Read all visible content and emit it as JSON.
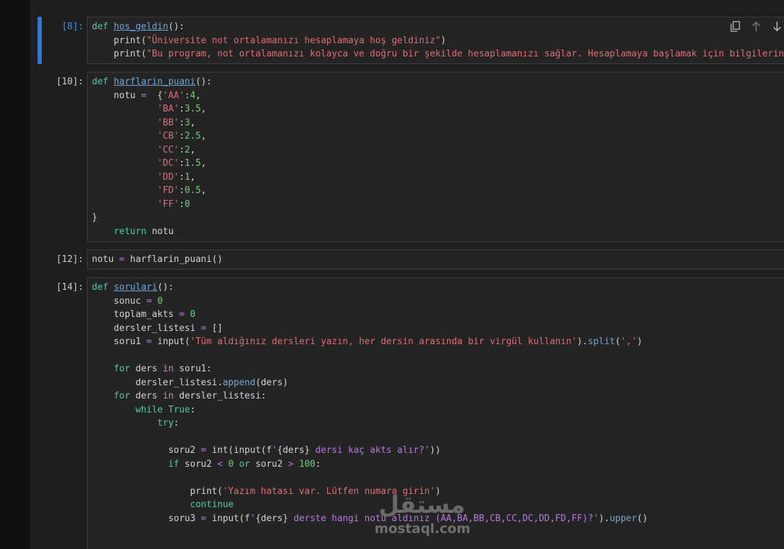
{
  "cells": [
    {
      "prompt": "[8]:",
      "active": true,
      "lines": [
        [
          [
            "kw",
            "def "
          ],
          [
            "fn",
            "hos_geldin"
          ],
          [
            "plain",
            "():"
          ]
        ],
        [
          [
            "plain",
            "    print("
          ],
          [
            "str",
            "\"Üniversite not ortalamanızı hesaplamaya hoş geldiniz\""
          ],
          [
            "plain",
            ")"
          ]
        ],
        [
          [
            "plain",
            "    print("
          ],
          [
            "str",
            "\"Bu program, not ortalamanızı kolayca ve doğru bir şekilde hesaplamanızı sağlar. Hesaplamaya başlamak için bilgilerinizi"
          ]
        ]
      ]
    },
    {
      "prompt": "[10]:",
      "active": false,
      "lines": [
        [
          [
            "kw",
            "def "
          ],
          [
            "fn",
            "harflarin_puani"
          ],
          [
            "plain",
            "():"
          ]
        ],
        [
          [
            "plain",
            "    notu "
          ],
          [
            "op",
            "="
          ],
          [
            "plain",
            "  {"
          ],
          [
            "str",
            "'AA'"
          ],
          [
            "plain",
            ":"
          ],
          [
            "num",
            "4"
          ],
          [
            "plain",
            ","
          ]
        ],
        [
          [
            "plain",
            "            "
          ],
          [
            "str",
            "'BA'"
          ],
          [
            "plain",
            ":"
          ],
          [
            "num",
            "3.5"
          ],
          [
            "plain",
            ","
          ]
        ],
        [
          [
            "plain",
            "            "
          ],
          [
            "str",
            "'BB'"
          ],
          [
            "plain",
            ":"
          ],
          [
            "num",
            "3"
          ],
          [
            "plain",
            ","
          ]
        ],
        [
          [
            "plain",
            "            "
          ],
          [
            "str",
            "'CB'"
          ],
          [
            "plain",
            ":"
          ],
          [
            "num",
            "2.5"
          ],
          [
            "plain",
            ","
          ]
        ],
        [
          [
            "plain",
            "            "
          ],
          [
            "str",
            "'CC'"
          ],
          [
            "plain",
            ":"
          ],
          [
            "num",
            "2"
          ],
          [
            "plain",
            ","
          ]
        ],
        [
          [
            "plain",
            "            "
          ],
          [
            "str",
            "'DC'"
          ],
          [
            "plain",
            ":"
          ],
          [
            "num",
            "1.5"
          ],
          [
            "plain",
            ","
          ]
        ],
        [
          [
            "plain",
            "            "
          ],
          [
            "str",
            "'DD'"
          ],
          [
            "plain",
            ":"
          ],
          [
            "num",
            "1"
          ],
          [
            "plain",
            ","
          ]
        ],
        [
          [
            "plain",
            "            "
          ],
          [
            "str",
            "'FD'"
          ],
          [
            "plain",
            ":"
          ],
          [
            "num",
            "0.5"
          ],
          [
            "plain",
            ","
          ]
        ],
        [
          [
            "plain",
            "            "
          ],
          [
            "str",
            "'FF'"
          ],
          [
            "plain",
            ":"
          ],
          [
            "num",
            "0"
          ]
        ],
        [
          [
            "plain",
            "}"
          ]
        ],
        [
          [
            "plain",
            "    "
          ],
          [
            "kw",
            "return"
          ],
          [
            "plain",
            " notu"
          ]
        ]
      ]
    },
    {
      "prompt": "[12]:",
      "active": false,
      "lines": [
        [
          [
            "plain",
            "notu "
          ],
          [
            "op",
            "="
          ],
          [
            "plain",
            " harflarin_puani()"
          ]
        ]
      ]
    },
    {
      "prompt": "[14]:",
      "active": false,
      "lines": [
        [
          [
            "kw",
            "def "
          ],
          [
            "fn",
            "sorulari"
          ],
          [
            "plain",
            "():"
          ]
        ],
        [
          [
            "plain",
            "    sonuc "
          ],
          [
            "op",
            "="
          ],
          [
            "plain",
            " "
          ],
          [
            "num",
            "0"
          ]
        ],
        [
          [
            "plain",
            "    toplam_akts "
          ],
          [
            "op",
            "="
          ],
          [
            "plain",
            " "
          ],
          [
            "num",
            "0"
          ]
        ],
        [
          [
            "plain",
            "    dersler_listesi "
          ],
          [
            "op",
            "="
          ],
          [
            "plain",
            " []"
          ]
        ],
        [
          [
            "plain",
            "    soru1 "
          ],
          [
            "op",
            "="
          ],
          [
            "plain",
            " input("
          ],
          [
            "str",
            "'Tüm aldığınız dersleri yazın, her dersin arasında bir virgül kullanın'"
          ],
          [
            "plain",
            ")."
          ],
          [
            "method",
            "split"
          ],
          [
            "plain",
            "("
          ],
          [
            "str",
            "','"
          ],
          [
            "plain",
            ")"
          ]
        ],
        [
          [
            "plain",
            ""
          ]
        ],
        [
          [
            "plain",
            "    "
          ],
          [
            "kw",
            "for"
          ],
          [
            "plain",
            " ders "
          ],
          [
            "kw2",
            "in"
          ],
          [
            "plain",
            " soru1:"
          ]
        ],
        [
          [
            "plain",
            "        dersler_listesi."
          ],
          [
            "method",
            "append"
          ],
          [
            "plain",
            "(ders)"
          ]
        ],
        [
          [
            "plain",
            "    "
          ],
          [
            "kw",
            "for"
          ],
          [
            "plain",
            " ders "
          ],
          [
            "kw2",
            "in"
          ],
          [
            "plain",
            " dersler_listesi:"
          ]
        ],
        [
          [
            "plain",
            "        "
          ],
          [
            "kw",
            "while"
          ],
          [
            "plain",
            " "
          ],
          [
            "kw",
            "True"
          ],
          [
            "plain",
            ":"
          ]
        ],
        [
          [
            "plain",
            "            "
          ],
          [
            "kw",
            "try"
          ],
          [
            "plain",
            ":"
          ]
        ],
        [
          [
            "plain",
            ""
          ]
        ],
        [
          [
            "plain",
            "              soru2 "
          ],
          [
            "op",
            "="
          ],
          [
            "plain",
            " int(input(f"
          ],
          [
            "fstr",
            "'"
          ],
          [
            "plain",
            "{ders}"
          ],
          [
            "fstr",
            " dersi kaç akts alır?'"
          ],
          [
            "plain",
            "))"
          ]
        ],
        [
          [
            "plain",
            "              "
          ],
          [
            "kw",
            "if"
          ],
          [
            "plain",
            " soru2 "
          ],
          [
            "op",
            "<"
          ],
          [
            "plain",
            " "
          ],
          [
            "num",
            "0"
          ],
          [
            "plain",
            " "
          ],
          [
            "kw",
            "or"
          ],
          [
            "plain",
            " soru2 "
          ],
          [
            "op",
            ">"
          ],
          [
            "plain",
            " "
          ],
          [
            "num",
            "100"
          ],
          [
            "plain",
            ":"
          ]
        ],
        [
          [
            "plain",
            ""
          ]
        ],
        [
          [
            "plain",
            "                  print("
          ],
          [
            "str",
            "'Yazım hatası var. Lütfen numara girin'"
          ],
          [
            "plain",
            ")"
          ]
        ],
        [
          [
            "plain",
            "                  "
          ],
          [
            "kw",
            "continue"
          ]
        ],
        [
          [
            "plain",
            "              soru3 "
          ],
          [
            "op",
            "="
          ],
          [
            "plain",
            " input(f"
          ],
          [
            "fstr",
            "'"
          ],
          [
            "plain",
            "{ders}"
          ],
          [
            "fstr",
            " derste hangi notu aldınız (AA,BA,BB,CB,CC,DC,DD,FD,FF)?'"
          ],
          [
            "plain",
            ")."
          ],
          [
            "method",
            "upper"
          ],
          [
            "plain",
            "()"
          ]
        ]
      ]
    }
  ],
  "toolbar": {
    "icons": [
      "copy-icon",
      "arrow-up-icon",
      "arrow-down-icon"
    ]
  },
  "watermark": {
    "arabic": "مستقل",
    "latin": "mostaql.com"
  }
}
